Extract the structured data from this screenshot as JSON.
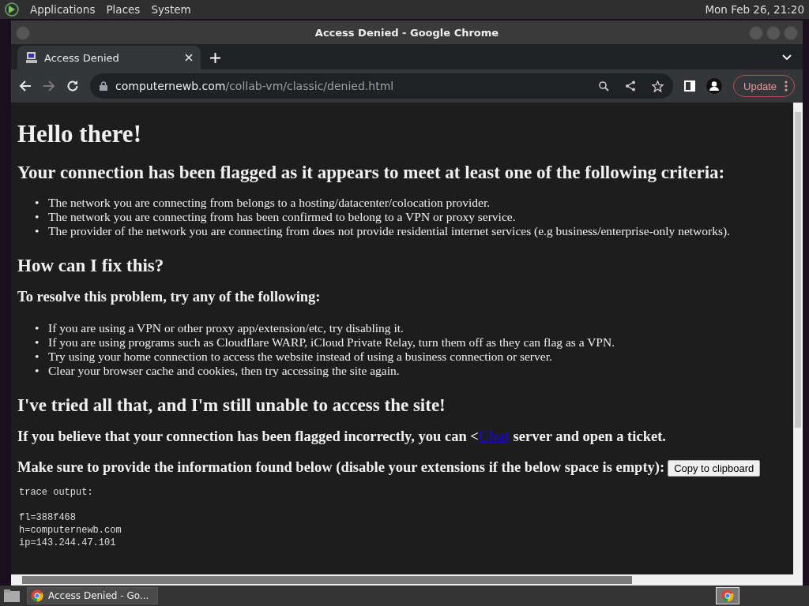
{
  "top_panel": {
    "menus": [
      "Applications",
      "Places",
      "System"
    ],
    "clock": "Mon Feb 26, 21:20"
  },
  "window": {
    "title": "Access Denied - Google Chrome"
  },
  "tabs": [
    {
      "label": "Access Denied",
      "selected": true
    }
  ],
  "address_bar": {
    "domain": "computernewb.com",
    "path": "/collab-vm/classic/denied.html"
  },
  "update_button": "Update",
  "page": {
    "heading": "Hello there!",
    "criteria_heading": "Your connection has been flagged as it appears to meet at least one of the following criteria:",
    "criteria": [
      {
        "marker": "•",
        "text": "The network you are connecting from belongs to a hosting/datacenter/colocation provider."
      },
      {
        "marker": "•",
        "text": "The network you are connecting from has been confirmed to belong to a VPN or proxy service."
      },
      {
        "marker": "•",
        "text": "The provider of the network you are connecting from does not provide residential internet services (e.g business/enterprise-only networks)."
      }
    ],
    "fix_heading": "How can I fix this?",
    "fix_intro": "To resolve this problem, try any of the following:",
    "fixes": [
      {
        "marker": "•",
        "text": "If you are using a VPN or other proxy app/extension/etc, try disabling it."
      },
      {
        "marker": "•",
        "text": "If you are using programs such as Cloudflare WARP, iCloud Private Relay, turn them off as they can flag as a VPN."
      },
      {
        "marker": "•",
        "text": "Try using your home connection to access the website instead of using a business connection or server."
      },
      {
        "marker": "•",
        "text": "Clear your browser cache and cookies, then try accessing the site again."
      }
    ],
    "tried_heading": "I've tried all that, and I'm still unable to access the site!",
    "contact": {
      "before": "If you believe that your connection has been flagged incorrectly, you can <",
      "link": "Chat",
      "after": " server and open a ticket."
    },
    "provide_text": "Make sure to provide the information found below (disable your extensions if the below space is empty):",
    "copy_button": "Copy to clipboard",
    "trace_title": "trace output:",
    "trace_lines": [
      "fl=388f468",
      "h=computernewb.com",
      "ip=143.244.47.101"
    ]
  },
  "taskbar": {
    "items": [
      {
        "label": "Access Denied - Go...",
        "selected": false
      }
    ]
  }
}
